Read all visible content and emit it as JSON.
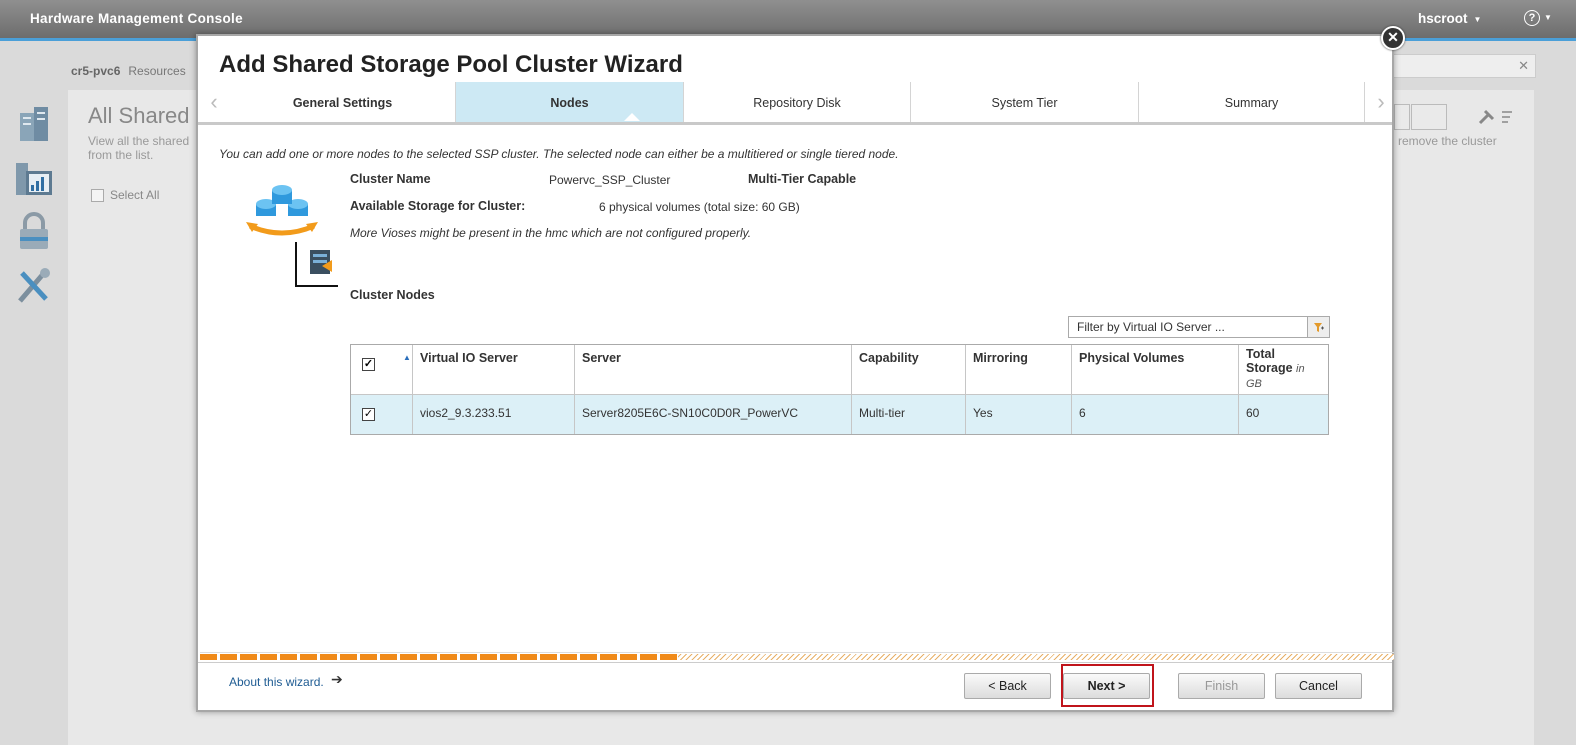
{
  "topbar": {
    "title": "Hardware Management Console",
    "user": "hscroot",
    "help_icon": "?"
  },
  "background": {
    "breadcrumb_system": "cr5-pvc6",
    "breadcrumb_section": "Resources",
    "heading": "All Shared",
    "description": "View all the shared from the list.",
    "select_all": "Select All",
    "search_placeholder": "h",
    "right_text": "remove the cluster"
  },
  "wizard": {
    "title": "Add Shared Storage Pool Cluster Wizard",
    "tabs": [
      {
        "label": "General Settings"
      },
      {
        "label": "Nodes"
      },
      {
        "label": "Repository Disk"
      },
      {
        "label": "System Tier"
      },
      {
        "label": "Summary"
      }
    ],
    "intro": "You can add one or more nodes to the selected SSP cluster. The selected node can either be a multitiered or single tiered node.",
    "cluster_name_label": "Cluster Name",
    "cluster_name_value": "Powervc_SSP_Cluster",
    "multi_tier_label": "Multi-Tier Capable",
    "available_storage_label": "Available Storage for Cluster:",
    "available_storage_value": "6 physical volumes (total size: 60 GB)",
    "note": "More Vioses might be present in the hmc which are not configured properly.",
    "cluster_nodes_label": "Cluster Nodes",
    "filter_placeholder": "Filter by Virtual IO Server ...",
    "table": {
      "headers": {
        "vios": "Virtual IO Server",
        "server": "Server",
        "capability": "Capability",
        "mirroring": "Mirroring",
        "pv": "Physical Volumes",
        "total_storage": "Total Storage",
        "total_storage_unit": "in GB"
      },
      "rows": [
        {
          "checked": true,
          "vios": "vios2_9.3.233.51",
          "server": "Server8205E6C-SN10C0D0R_PowerVC",
          "capability": "Multi-tier",
          "mirroring": "Yes",
          "pv": "6",
          "total_storage": "60"
        }
      ]
    },
    "progress_fraction": 0.4,
    "about": "About this wizard.",
    "buttons": {
      "back": "< Back",
      "next": "Next >",
      "finish": "Finish",
      "cancel": "Cancel"
    }
  },
  "colors": {
    "accent_orange": "#f08a19",
    "tab_active": "#cde9f4",
    "row_selected": "#dcf0f7",
    "highlight_red": "#c0141b",
    "link": "#1f5c93"
  }
}
